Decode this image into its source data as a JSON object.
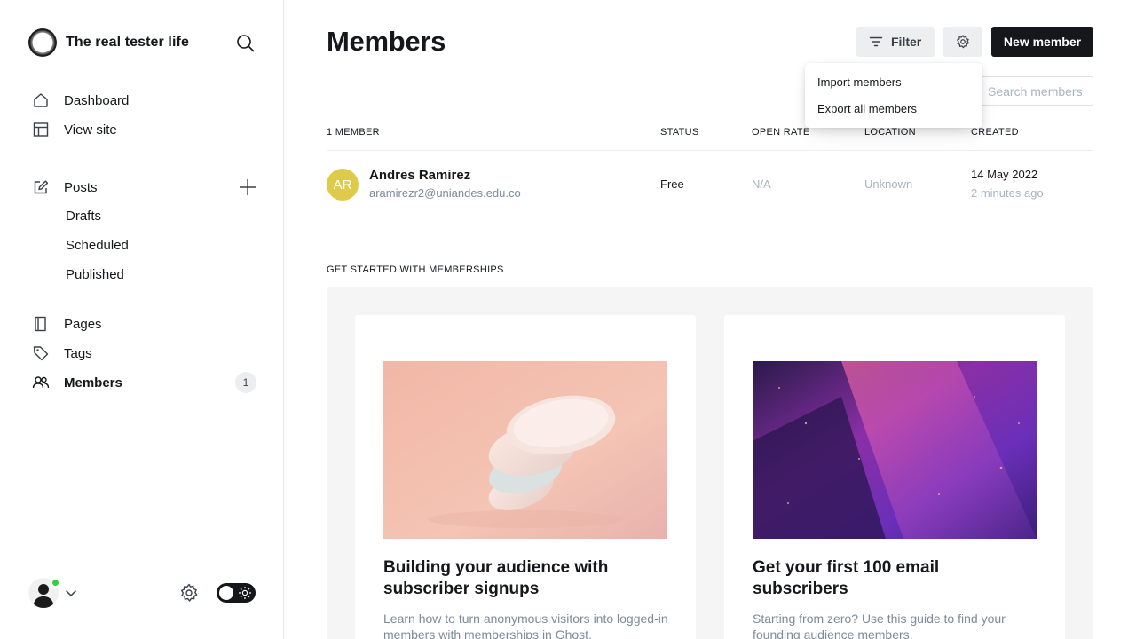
{
  "site": {
    "title": "The real tester life"
  },
  "nav": {
    "dashboard": "Dashboard",
    "view_site": "View site",
    "posts": "Posts",
    "drafts": "Drafts",
    "scheduled": "Scheduled",
    "published": "Published",
    "pages": "Pages",
    "tags": "Tags",
    "members": "Members",
    "members_count": "1"
  },
  "header": {
    "title": "Members",
    "filter_label": "Filter",
    "new_member_label": "New member",
    "search_placeholder": "Search members..."
  },
  "dropdown": {
    "items": [
      "Import members",
      "Export all members"
    ]
  },
  "table": {
    "columns": [
      "1 MEMBER",
      "STATUS",
      "OPEN RATE",
      "LOCATION",
      "CREATED"
    ],
    "rows": [
      {
        "initials": "AR",
        "name": "Andres Ramirez",
        "email": "aramirezr2@uniandes.edu.co",
        "status": "Free",
        "open_rate": "N/A",
        "location": "Unknown",
        "created": "14 May 2022",
        "created_ago": "2 minutes ago"
      }
    ]
  },
  "get_started": {
    "title": "GET STARTED WITH MEMBERSHIPS",
    "cards": [
      {
        "title": "Building your audience with subscriber signups",
        "text": "Learn how to turn anonymous visitors into logged-in members with memberships in Ghost."
      },
      {
        "title": "Get your first 100 email subscribers",
        "text": "Starting from zero? Use this guide to find your founding audience members."
      }
    ]
  },
  "colors": {
    "accent": "#15171a",
    "avatar": "#dfca4a",
    "online": "#30cf43",
    "panel_bg": "#f4f5f4"
  }
}
